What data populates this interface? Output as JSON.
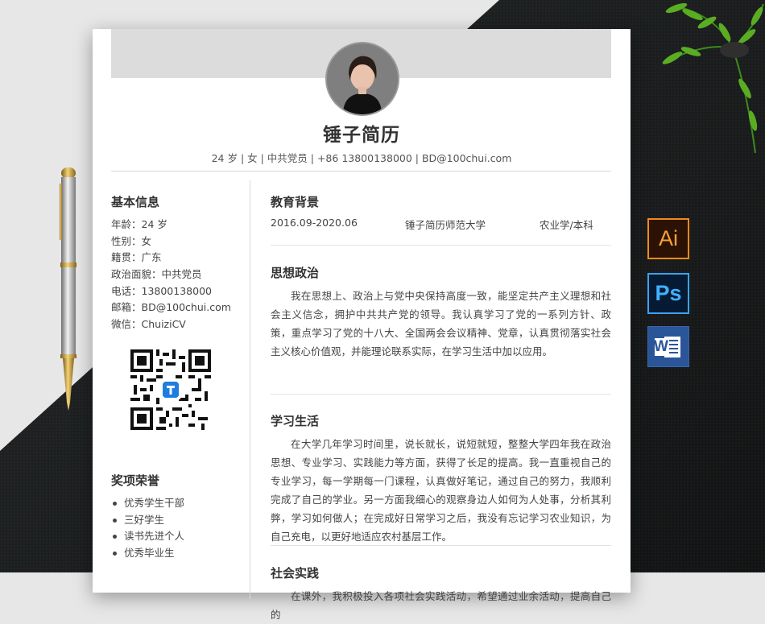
{
  "resume": {
    "name": "锤子简历",
    "contact_line": "24 岁 | 女 | 中共党员 | +86 13800138000 | BD@100chui.com"
  },
  "left_column": {
    "basic_info": {
      "title": "基本信息",
      "rows": [
        "年龄：24 岁",
        "性别：女",
        "籍贯：广东",
        "政治面貌：中共党员",
        "电话：13800138000",
        "邮箱：BD@100chui.com",
        "微信：ChuiziCV"
      ]
    },
    "awards": {
      "title": "奖项荣誉",
      "items": [
        "优秀学生干部",
        "三好学生",
        "读书先进个人",
        "优秀毕业生"
      ]
    }
  },
  "right_column": {
    "education": {
      "title": "教育背景",
      "period": "2016.09-2020.06",
      "school": "锤子简历师范大学",
      "major": "农业学/本科"
    },
    "politics": {
      "title": "思想政治",
      "text": "我在思想上、政治上与党中央保持高度一致，能坚定共产主义理想和社会主义信念，拥护中共共产党的领导。我认真学习了党的一系列方针、政策，重点学习了党的十八大、全国两会会议精神、党章，认真贯彻落实社会主义核心价值观，并能理论联系实际，在学习生活中加以应用。"
    },
    "study": {
      "title": "学习生活",
      "text": "在大学几年学习时间里，说长就长，说短就短，整整大学四年我在政治思想、专业学习、实践能力等方面，获得了长足的提高。我一直重视自己的专业学习，每一学期每一门课程，认真做好笔记，通过自己的努力，我顺利完成了自己的学业。另一方面我细心的观察身边人如何为人处事，分析其利弊，学习如何做人；在完成好日常学习之后，我没有忘记学习农业知识，为自己充电，以更好地适应农村基层工作。"
    },
    "practice": {
      "title": "社会实践",
      "text": "在课外，我积极投入各项社会实践活动，希望通过业余活动，提高自己的"
    }
  },
  "software_icons": {
    "ai_label": "Ai",
    "ps_label": "Ps",
    "word_label": "W",
    "ai_color": "#f6a234",
    "ps_color": "#41b0ff",
    "word_color": "#2a5699"
  }
}
